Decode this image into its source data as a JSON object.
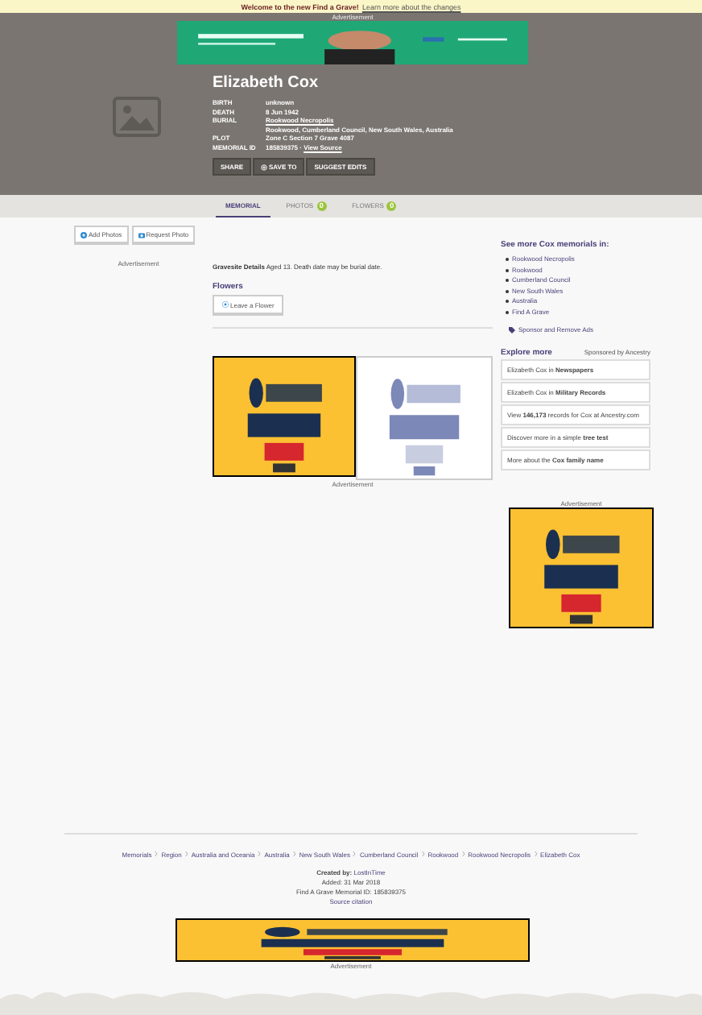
{
  "notice": {
    "text": "Welcome to the new Find a Grave!",
    "link": "Learn more about the changes"
  },
  "header_ad": {
    "label": "Advertisement"
  },
  "memorial": {
    "name": "Elizabeth Cox",
    "facts": [
      {
        "label": "BIRTH",
        "value": "unknown"
      },
      {
        "label": "DEATH",
        "value": "8 Jun 1942"
      },
      {
        "label": "BURIAL",
        "value": "Rookwood Necropolis",
        "kind": "link"
      },
      {
        "value": "Rookwood, Cumberland Council, New South Wales, Australia"
      },
      {
        "label": "PLOT",
        "value": "Zone C Section 7 Grave 4087"
      },
      {
        "label": "MEMORIAL ID",
        "value": "185839375 ·",
        "link": "View Source"
      }
    ],
    "actions": [
      {
        "label": "SHARE",
        "icon": false
      },
      {
        "label": "SAVE TO",
        "icon": true
      },
      {
        "label": "SUGGEST EDITS",
        "icon": false
      }
    ]
  },
  "tabs": [
    {
      "label": "MEMORIAL",
      "selected": true
    },
    {
      "label": "PHOTOS",
      "count": "0",
      "selected": false
    },
    {
      "label": "FLOWERS",
      "count": "0",
      "selected": false
    }
  ],
  "photo_buttons": [
    "Add Photos",
    "Request Photo"
  ],
  "left_ad_label": "Advertisement",
  "gravesite": {
    "label": "Gravesite Details",
    "text": "Aged 13. Death date may be burial date."
  },
  "flowers": {
    "heading": "Flowers",
    "button": "Leave a Flower"
  },
  "middle_ad_label": "Advertisement",
  "see_more": {
    "heading": "See more Cox memorials in:",
    "items": [
      "Rookwood Necropolis",
      "Rookwood",
      "Cumberland Council",
      "New South Wales",
      "Australia",
      "Find A Grave"
    ],
    "sponsor": "Sponsor and Remove Ads"
  },
  "explore": {
    "heading": "Explore more",
    "sponsor": "Sponsored by Ancestry",
    "links": [
      {
        "pre": "Elizabeth Cox in",
        "bold": "Newspapers"
      },
      {
        "pre": "Elizabeth Cox in",
        "bold": "Military Records"
      },
      {
        "pre": "View",
        "bold": "146,173",
        "post": "records for Cox at Ancestry.com"
      },
      {
        "pre": "Discover more in a simple",
        "bold": "tree test"
      },
      {
        "pre": "More about the",
        "bold": "Cox family name"
      }
    ]
  },
  "right_ad_label": "Advertisement",
  "breadcrumbs": [
    "Memorials",
    "Region",
    "Australia and Oceania",
    "Australia",
    "New South Wales",
    "Cumberland Council",
    "Rookwood",
    "Rookwood Necropolis",
    "Elizabeth Cox"
  ],
  "credits": {
    "created_label": "Created by:",
    "created_by": "LostInTime",
    "added": "Added: 31 Mar 2018",
    "memorial_id": "Find A Grave Memorial ID: 185839375",
    "citation": "Source citation"
  },
  "footer_ad_label": "Advertisement"
}
